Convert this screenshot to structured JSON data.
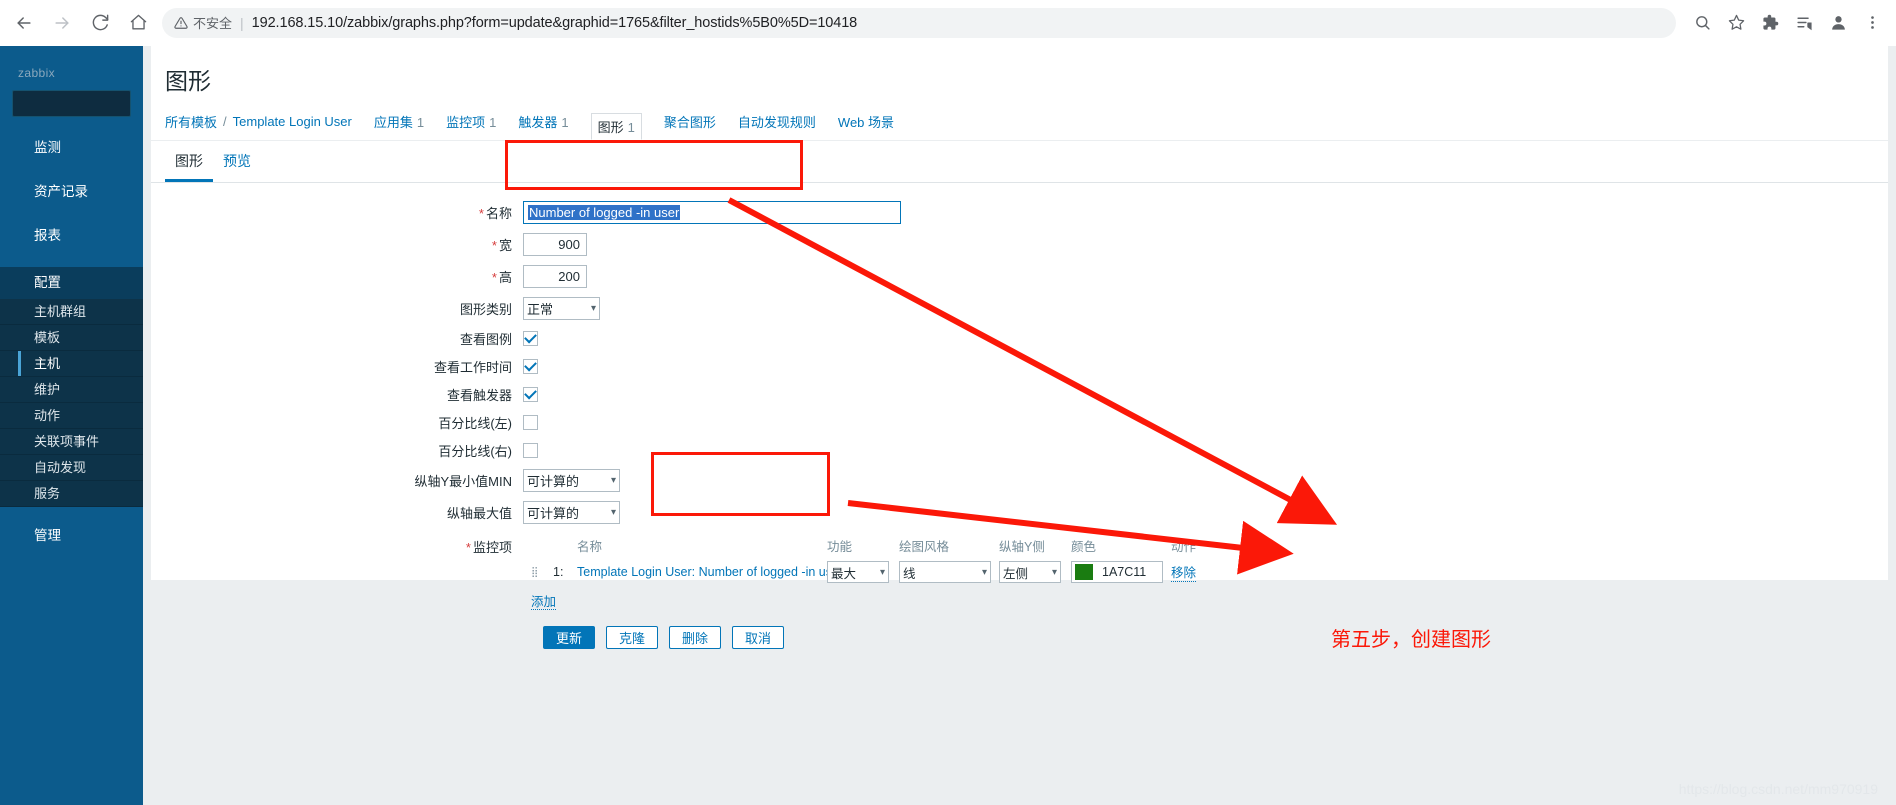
{
  "browser": {
    "back_icon": "back-arrow-icon",
    "forward_icon": "forward-arrow-icon",
    "reload_icon": "reload-icon",
    "home_icon": "home-icon",
    "security_label": "不安全",
    "url": "192.168.15.10/zabbix/graphs.php?form=update&graphid=1765&filter_hostids%5B0%5D=10418",
    "zoom_icon": "search-zoom-icon",
    "bookmark_icon": "star-icon",
    "extensions_icon": "puzzle-piece-icon",
    "readlist_icon": "reading-list-icon",
    "profile_icon": "profile-avatar-icon",
    "menu_icon": "three-dot-menu-icon"
  },
  "sidebar": {
    "logo": "zabbix",
    "search_placeholder": "",
    "items": [
      {
        "label": "监测",
        "active": false
      },
      {
        "label": "资产记录",
        "active": false
      },
      {
        "label": "报表",
        "active": false
      },
      {
        "label": "配置",
        "active": true
      }
    ],
    "sub_items": [
      {
        "label": "主机群组",
        "selected": false
      },
      {
        "label": "模板",
        "selected": false
      },
      {
        "label": "主机",
        "selected": true
      },
      {
        "label": "维护",
        "selected": false
      },
      {
        "label": "动作",
        "selected": false
      },
      {
        "label": "关联项事件",
        "selected": false
      },
      {
        "label": "自动发现",
        "selected": false
      },
      {
        "label": "服务",
        "selected": false
      }
    ],
    "bottom_item": {
      "label": "管理"
    }
  },
  "page": {
    "title": "图形",
    "breadcrumb": {
      "root": "所有模板",
      "separator": "/",
      "template": "Template Login User",
      "tabs": [
        {
          "label": "应用集",
          "count": "1",
          "current": false
        },
        {
          "label": "监控项",
          "count": "1",
          "current": false
        },
        {
          "label": "触发器",
          "count": "1",
          "current": false
        },
        {
          "label": "图形",
          "count": "1",
          "current": true
        },
        {
          "label": "聚合图形",
          "count": "",
          "current": false
        },
        {
          "label": "自动发现规则",
          "count": "",
          "current": false
        },
        {
          "label": "Web 场景",
          "count": "",
          "current": false
        }
      ]
    },
    "tabs": [
      {
        "label": "图形",
        "active": true
      },
      {
        "label": "预览",
        "active": false
      }
    ]
  },
  "form": {
    "name": {
      "label": "名称",
      "required": true,
      "value": "Number of logged -in user",
      "selected": true
    },
    "width": {
      "label": "宽",
      "required": true,
      "value": "900"
    },
    "height": {
      "label": "高",
      "required": true,
      "value": "200"
    },
    "graph_type": {
      "label": "图形类别",
      "value": "正常"
    },
    "show_legend": {
      "label": "查看图例",
      "checked": true
    },
    "show_working_time": {
      "label": "查看工作时间",
      "checked": true
    },
    "show_triggers": {
      "label": "查看触发器",
      "checked": true
    },
    "percentile_left": {
      "label": "百分比线(左)",
      "checked": false
    },
    "percentile_right": {
      "label": "百分比线(右)",
      "checked": false
    },
    "y_min": {
      "label": "纵轴Y最小值MIN",
      "value": "可计算的"
    },
    "y_max": {
      "label": "纵轴最大值",
      "value": "可计算的"
    },
    "items": {
      "label": "监控项",
      "required": true,
      "headers": {
        "name": "名称",
        "function": "功能",
        "draw_style": "绘图风格",
        "y_axis_side": "纵轴Y侧",
        "color": "颜色",
        "action": "动作"
      },
      "rows": [
        {
          "index": "1:",
          "name": "Template Login User: Number of logged -in user",
          "function": "最大",
          "draw_style": "线",
          "y_axis_side": "左侧",
          "color_hex": "1A7C11",
          "color_value": "#1A7C11",
          "action": "移除"
        }
      ],
      "add_label": "添加"
    },
    "buttons": [
      {
        "label": "更新",
        "primary": true
      },
      {
        "label": "克隆",
        "primary": false
      },
      {
        "label": "删除",
        "primary": false
      },
      {
        "label": "取消",
        "primary": false
      }
    ]
  },
  "annotations": {
    "accent_color": "#fb1808",
    "step_text": "第五步，创建图形"
  },
  "watermark": "https://blog.csdn.net/mm970919"
}
